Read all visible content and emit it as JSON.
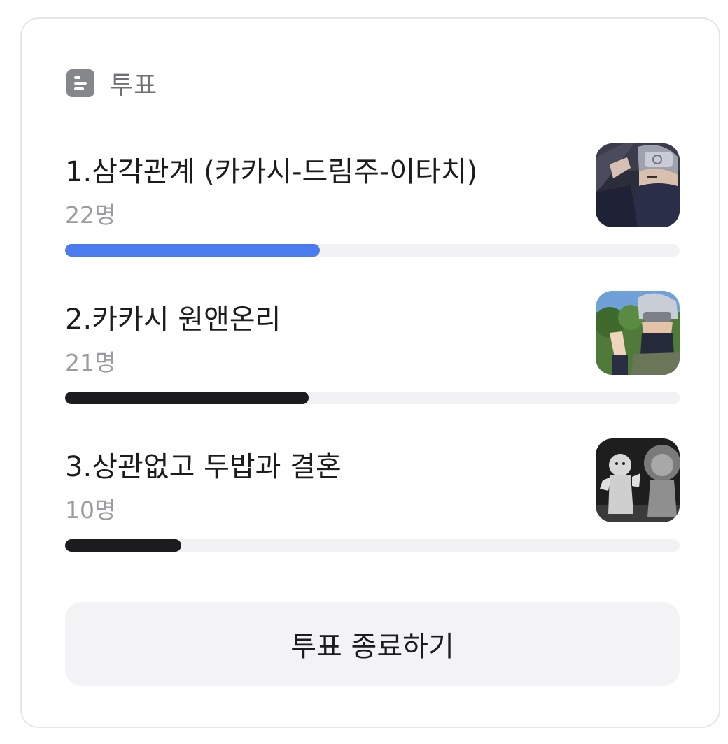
{
  "poll": {
    "title": "투표",
    "icon": "poll-list-icon",
    "accent_color": "#4a7cf0",
    "bar_color": "#1c1c1e",
    "options": [
      {
        "label": "1.삼각관계 (카카시-드림주-이타치)",
        "count": "22명",
        "share": 0.415,
        "highlighted": true,
        "thumbnail": "kakashi-masked-thumbnail"
      },
      {
        "label": "2.카카시 원앤온리",
        "count": "21명",
        "share": 0.396,
        "highlighted": false,
        "thumbnail": "kakashi-waving-thumbnail"
      },
      {
        "label": "3.상관없고 두밥과 결혼",
        "count": "10명",
        "share": 0.189,
        "highlighted": false,
        "thumbnail": "dog-and-lion-thumbnail"
      }
    ],
    "end_button_label": "투표 종료하기"
  }
}
